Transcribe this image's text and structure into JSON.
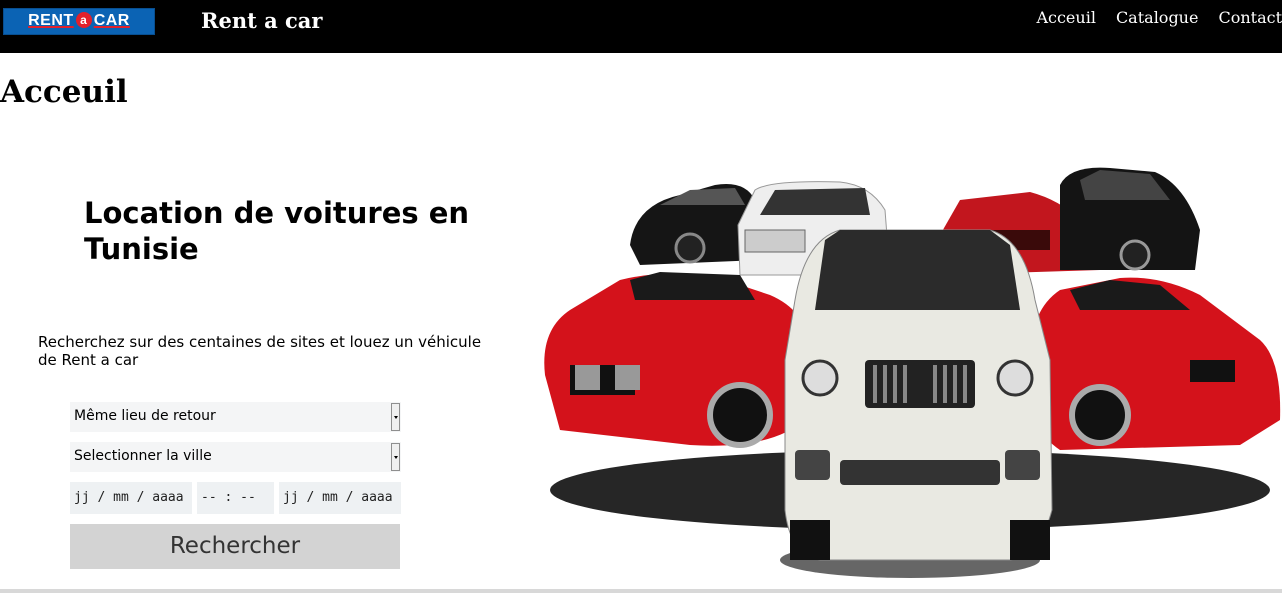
{
  "header": {
    "logo_text": "RENT a CAR",
    "logo_left": "RENT",
    "logo_mid": "a",
    "logo_right": "CAR",
    "site_title": "Rent a car",
    "nav": [
      "Acceuil",
      "Catalogue",
      "Contact"
    ]
  },
  "page": {
    "heading": "Acceuil"
  },
  "hero": {
    "title": "Location de voitures en Tunisie",
    "description": "Recherchez sur des centaines de sites et louez un véhicule de Rent a car"
  },
  "form": {
    "return_select_value": "Même lieu de retour",
    "city_select_value": "Selectionner la ville",
    "pickup_date_placeholder": "jj / mm / aaaa",
    "pickup_time_placeholder": "-- : --",
    "return_date_placeholder": "jj / mm / aaaa",
    "search_label": "Rechercher"
  },
  "colors": {
    "header_bg": "#000000",
    "logo_blue": "#0b63b4",
    "logo_red": "#e3202a",
    "button_bg": "#d3d3d3"
  },
  "hero_image": "photo of several cars: two red convertibles, a white SUV in front, black and white sedans behind"
}
